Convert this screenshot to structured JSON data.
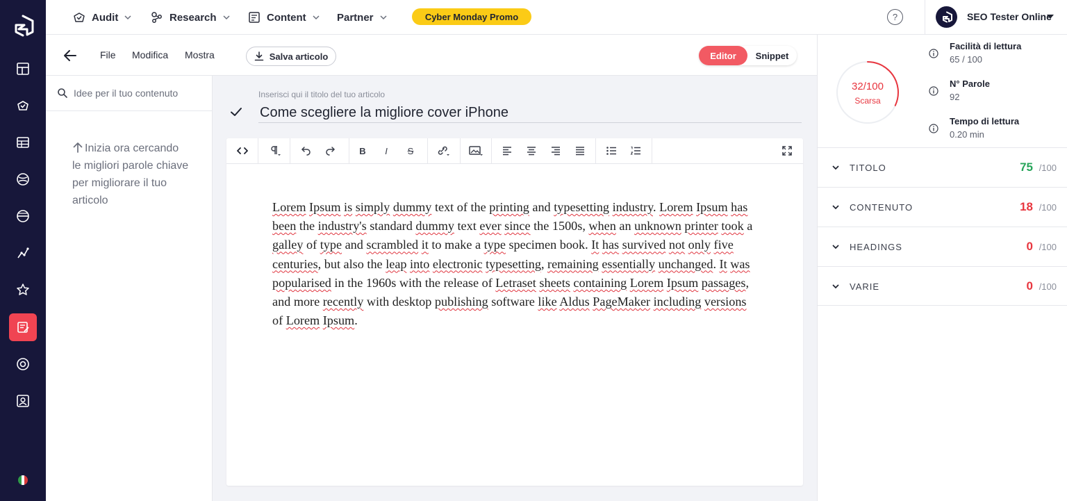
{
  "colors": {
    "rail_bg": "#17173a",
    "accent_red": "#f04452",
    "promo_yellow": "#fbcb16",
    "score_green": "#27a55a",
    "score_red": "#e8363f"
  },
  "topnav": {
    "items": [
      {
        "label": "Audit",
        "icon": "audit-icon"
      },
      {
        "label": "Research",
        "icon": "research-icon"
      },
      {
        "label": "Content",
        "icon": "content-icon"
      },
      {
        "label": "Partner",
        "icon": ""
      }
    ],
    "promo_label": "Cyber Monday Promo",
    "help_label": "?",
    "account_name": "SEO Tester Online"
  },
  "toolbar": {
    "menus": [
      "File",
      "Modifica",
      "Mostra"
    ],
    "save_label": "Salva articolo",
    "mode_editor": "Editor",
    "mode_snippet": "Snippet"
  },
  "keywords": {
    "search_placeholder": "Idee per il tuo contenuto",
    "hint": "Inizia ora cercando le migliori parole chiave per migliorare il tuo articolo"
  },
  "editor": {
    "title_label": "Inserisci qui il titolo del tuo articolo",
    "title": "Come scegliere la migliore cover iPhone",
    "body": "Lorem Ipsum is simply dummy text of the printing and typesetting industry. Lorem Ipsum has been the industry's standard dummy text ever since the 1500s, when an unknown printer took a galley of type and scrambled it to make a type specimen book. It has survived not only five centuries, but also the leap into electronic typesetting, remaining essentially unchanged. It was popularised in the 1960s with the release of Letraset sheets containing Lorem Ipsum passages, and more recently with desktop publishing software like Aldus PageMaker including versions of Lorem Ipsum."
  },
  "analysis": {
    "score": {
      "value": "32/100",
      "label": "Scarsa",
      "fraction": 0.32
    },
    "metrics": [
      {
        "label": "Facilità di lettura",
        "value": "65 / 100"
      },
      {
        "label": "N° Parole",
        "value": "92"
      },
      {
        "label": "Tempo di lettura",
        "value": "0.20 min"
      }
    ],
    "sections": [
      {
        "name": "TITOLO",
        "score": "75",
        "max": "/100",
        "color": "#27a55a"
      },
      {
        "name": "CONTENUTO",
        "score": "18",
        "max": "/100",
        "color": "#e8363f"
      },
      {
        "name": "HEADINGS",
        "score": "0",
        "max": "/100",
        "color": "#e8363f"
      },
      {
        "name": "VARIE",
        "score": "0",
        "max": "/100",
        "color": "#e8363f"
      }
    ]
  }
}
